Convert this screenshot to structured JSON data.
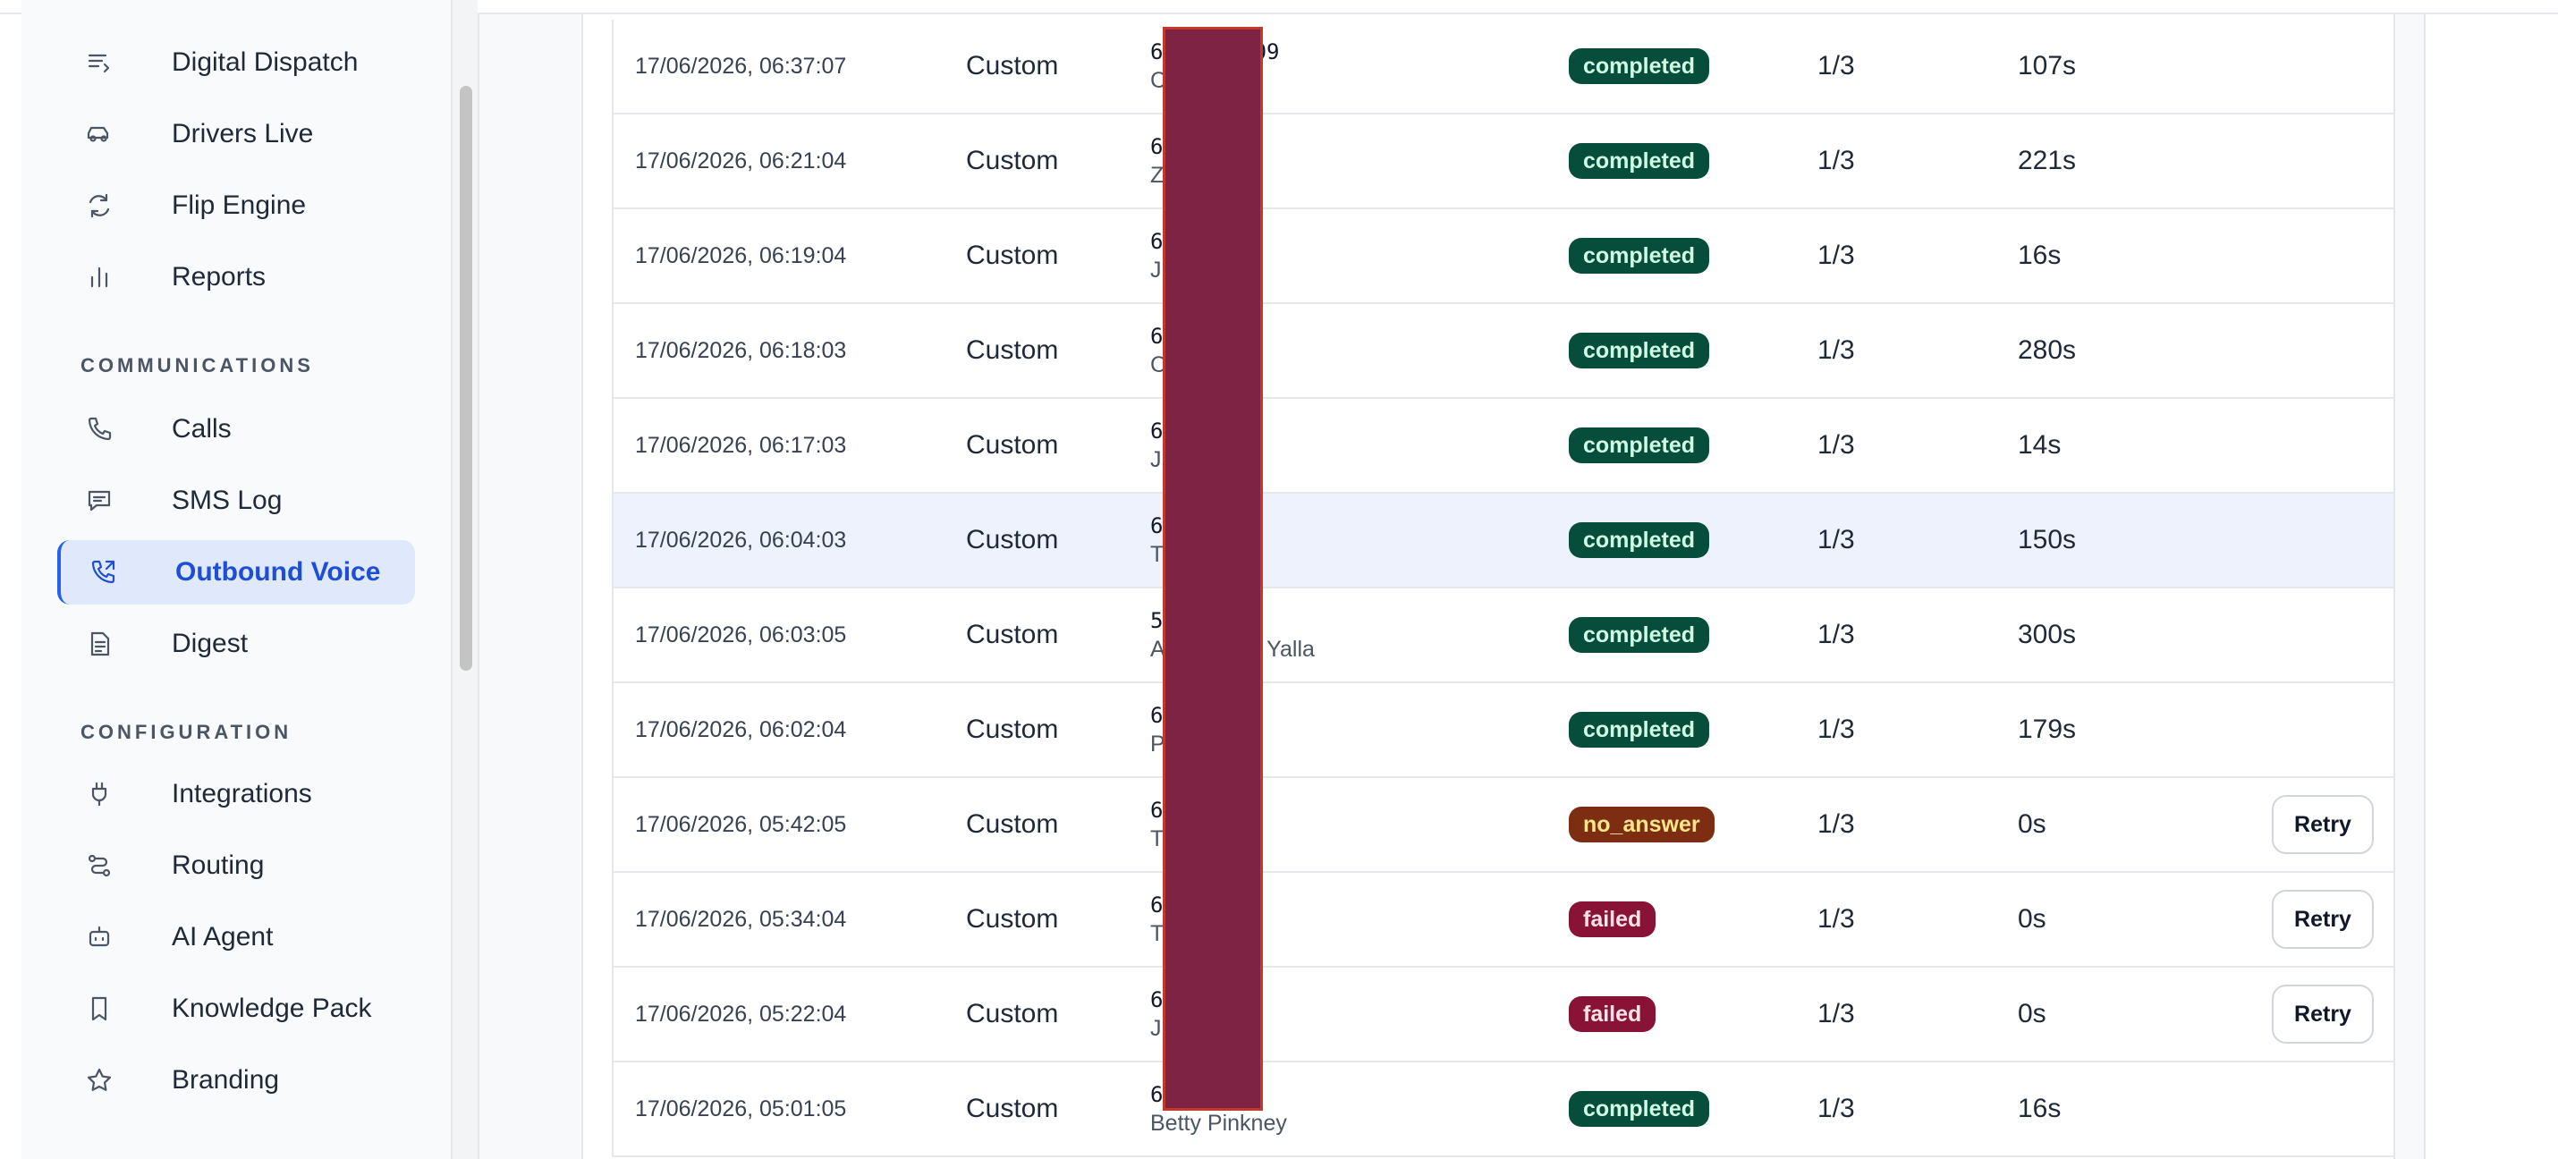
{
  "sidebar": {
    "items_top": [
      {
        "label": "Digital Dispatch",
        "icon": "list-icon"
      },
      {
        "label": "Drivers Live",
        "icon": "car-icon"
      },
      {
        "label": "Flip Engine",
        "icon": "refresh-icon"
      },
      {
        "label": "Reports",
        "icon": "bar-chart-icon"
      }
    ],
    "section_communications": "COMMUNICATIONS",
    "items_comm": [
      {
        "label": "Calls",
        "icon": "phone-icon"
      },
      {
        "label": "SMS Log",
        "icon": "message-icon"
      },
      {
        "label": "Outbound Voice",
        "icon": "phone-outgoing-icon",
        "active": true
      },
      {
        "label": "Digest",
        "icon": "document-icon"
      }
    ],
    "section_configuration": "CONFIGURATION",
    "items_config": [
      {
        "label": "Integrations",
        "icon": "plug-icon"
      },
      {
        "label": "Routing",
        "icon": "route-icon"
      },
      {
        "label": "AI Agent",
        "icon": "bot-icon"
      },
      {
        "label": "Knowledge Pack",
        "icon": "bookmark-icon"
      },
      {
        "label": "Branding",
        "icon": "star-icon"
      }
    ]
  },
  "calls": {
    "rows": [
      {
        "time": "17/06/2026, 06:37:07",
        "type": "Custom",
        "phone": "6145058209",
        "name": "C          uck",
        "status": "completed",
        "attempt": "1/3",
        "duration": "107s",
        "retry": ""
      },
      {
        "time": "17/06/2026, 06:21:04",
        "type": "Custom",
        "phone": "6        3",
        "name": "Z          n",
        "status": "completed",
        "attempt": "1/3",
        "duration": "221s",
        "retry": ""
      },
      {
        "time": "17/06/2026, 06:19:04",
        "type": "Custom",
        "phone": "6        1",
        "name": "J          erardi",
        "status": "completed",
        "attempt": "1/3",
        "duration": "16s",
        "retry": ""
      },
      {
        "time": "17/06/2026, 06:18:03",
        "type": "Custom",
        "phone": "6        3",
        "name": "C          derson",
        "status": "completed",
        "attempt": "1/3",
        "duration": "280s",
        "retry": ""
      },
      {
        "time": "17/06/2026, 06:17:03",
        "type": "Custom",
        "phone": "6        1",
        "name": "J",
        "status": "completed",
        "attempt": "1/3",
        "duration": "14s",
        "retry": ""
      },
      {
        "time": "17/06/2026, 06:04:03",
        "type": "Custom",
        "phone": "6        8",
        "name": "T",
        "status": "completed",
        "attempt": "1/3",
        "duration": "150s",
        "retry": "",
        "highlight": true
      },
      {
        "time": "17/06/2026, 06:03:05",
        "type": "Custom",
        "phone": "5        2",
        "name": "A          chamukh Yalla",
        "status": "completed",
        "attempt": "1/3",
        "duration": "300s",
        "retry": ""
      },
      {
        "time": "17/06/2026, 06:02:04",
        "type": "Custom",
        "phone": "6        0",
        "name": "P          n",
        "status": "completed",
        "attempt": "1/3",
        "duration": "179s",
        "retry": ""
      },
      {
        "time": "17/06/2026, 05:42:05",
        "type": "Custom",
        "phone": "6        2",
        "name": "T          n",
        "status": "no_answer",
        "attempt": "1/3",
        "duration": "0s",
        "retry": "Retry"
      },
      {
        "time": "17/06/2026, 05:34:04",
        "type": "Custom",
        "phone": "6        6",
        "name": "T          ker",
        "status": "failed",
        "attempt": "1/3",
        "duration": "0s",
        "retry": "Retry"
      },
      {
        "time": "17/06/2026, 05:22:04",
        "type": "Custom",
        "phone": "6        1",
        "name": "J          ush",
        "status": "failed",
        "attempt": "1/3",
        "duration": "0s",
        "retry": "Retry"
      },
      {
        "time": "17/06/2026, 05:01:05",
        "type": "Custom",
        "phone": "6        9",
        "name": "Betty Pinkney",
        "status": "completed",
        "attempt": "1/3",
        "duration": "16s",
        "retry": ""
      }
    ]
  },
  "colors": {
    "accent": "#1d4ed8",
    "completed": "#064e3b",
    "no_answer": "#7c2d12",
    "failed": "#881337",
    "redaction": "#7e2344"
  }
}
